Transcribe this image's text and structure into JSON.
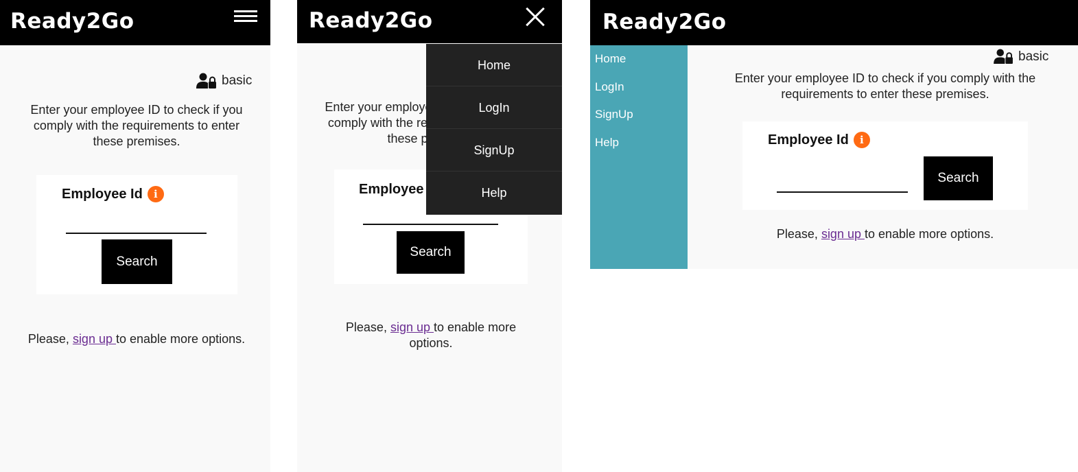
{
  "brand": "Ready2Go",
  "user_label": "basic",
  "intro_text": "Enter your employee ID to check if you comply with the requirements to enter these premises.",
  "employee_label": "Employee Id",
  "info_glyph": "i",
  "search_label": "Search",
  "footer": {
    "prefix": "Please, ",
    "link": "sign up ",
    "suffix": "to enable more options."
  },
  "nav": {
    "items": [
      {
        "label": "Home"
      },
      {
        "label": "LogIn"
      },
      {
        "label": "SignUp"
      },
      {
        "label": "Help"
      }
    ]
  },
  "colors": {
    "topbar": "#000000",
    "sidebar": "#4aa6b5",
    "dropdown": "#222222",
    "info_accent": "#ff6a13",
    "link": "#6a2c91"
  },
  "icons": {
    "menu": "hamburger-icon",
    "close": "close-icon",
    "user": "user-lock-icon",
    "info": "info-icon"
  }
}
